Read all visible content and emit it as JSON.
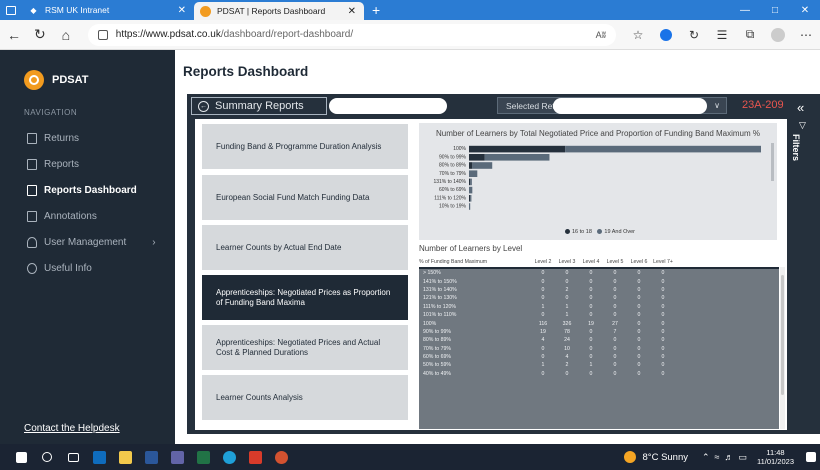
{
  "browser": {
    "tabs": [
      {
        "title": "RSM UK Intranet",
        "active": false
      },
      {
        "title": "PDSAT | Reports Dashboard",
        "active": true
      }
    ],
    "new_tab": "+",
    "url_host": "https://www.pdsat.co.uk",
    "url_path": "/dashboard/report-dashboard/",
    "reader_icon": "Aʬ"
  },
  "sidebar": {
    "brand": "PDSAT",
    "heading": "NAVIGATION",
    "items": [
      {
        "label": "Returns",
        "icon": "arrow-in-icon",
        "active": false
      },
      {
        "label": "Reports",
        "icon": "report-icon",
        "active": false
      },
      {
        "label": "Reports Dashboard",
        "icon": "dashboard-icon",
        "active": true
      },
      {
        "label": "Annotations",
        "icon": "annotation-icon",
        "active": false
      },
      {
        "label": "User Management",
        "icon": "user-icon",
        "active": false
      },
      {
        "label": "Useful Info",
        "icon": "info-icon",
        "active": false
      }
    ],
    "user_mgmt_chevron": "›",
    "helpdesk": "Contact the Helpdesk"
  },
  "main": {
    "title": "Reports Dashboard"
  },
  "report": {
    "summary_label": "Summary Reports",
    "selected_return_label": "Selected Return",
    "return_code": "23A-209",
    "buttons": [
      {
        "label": "Funding Band & Programme Duration Analysis",
        "active": false
      },
      {
        "label": "European Social Fund Match Funding Data",
        "active": false
      },
      {
        "label": "Learner Counts by Actual End Date",
        "active": false
      },
      {
        "label": "Apprenticeships: Negotiated Prices as Proportion of Funding Band Maxima",
        "active": true
      },
      {
        "label": "Apprenticeships: Negotiated Prices and Actual Cost & Planned Durations",
        "active": false
      },
      {
        "label": "Learner Counts Analysis",
        "active": false
      }
    ],
    "filters_label": "Filters",
    "colors": {
      "dark": "#1f2a36",
      "series_a": "#25303c",
      "series_b": "#5a6a7a",
      "accent": "#e8554e"
    }
  },
  "chart_data": {
    "type": "bar",
    "orientation": "horizontal",
    "stacked": true,
    "title": "Number of Learners by Total Negotiated Price and Proportion of Funding Band Maximum %",
    "categories": [
      "100%",
      "90% to 99%",
      "80% to 89%",
      "70% to 79%",
      "131% to 140%",
      "60% to 69%",
      "111% to 120%",
      "10% to 19%"
    ],
    "series": [
      {
        "name": "16 to 18",
        "values": [
          116,
          19,
          4,
          0,
          1,
          0,
          1,
          0
        ],
        "color": "#25303c"
      },
      {
        "name": "19 And Over",
        "values": [
          236,
          78,
          24,
          10,
          2,
          4,
          1,
          1
        ],
        "color": "#5a6a7a"
      }
    ],
    "legend": "bottom-center",
    "grid": false
  },
  "table": {
    "title": "Number of Learners by Level",
    "columns": [
      "% of Funding Band Maximum",
      "Level 2",
      "Level 3",
      "Level 4",
      "Level 5",
      "Level 6",
      "Level 7+"
    ],
    "rows": [
      [
        "> 150%",
        "0",
        "0",
        "0",
        "0",
        "0",
        "0"
      ],
      [
        "141% to 150%",
        "0",
        "0",
        "0",
        "0",
        "0",
        "0"
      ],
      [
        "131% to 140%",
        "0",
        "2",
        "0",
        "0",
        "0",
        "0"
      ],
      [
        "121% to 130%",
        "0",
        "0",
        "0",
        "0",
        "0",
        "0"
      ],
      [
        "111% to 120%",
        "1",
        "1",
        "0",
        "0",
        "0",
        "0"
      ],
      [
        "101% to 110%",
        "0",
        "1",
        "0",
        "0",
        "0",
        "0"
      ],
      [
        "100%",
        "116",
        "326",
        "19",
        "27",
        "0",
        "0"
      ],
      [
        "90% to 99%",
        "19",
        "78",
        "0",
        "7",
        "0",
        "0"
      ],
      [
        "80% to 89%",
        "4",
        "24",
        "0",
        "0",
        "0",
        "0"
      ],
      [
        "70% to 79%",
        "0",
        "10",
        "0",
        "0",
        "0",
        "0"
      ],
      [
        "60% to 69%",
        "0",
        "4",
        "0",
        "0",
        "0",
        "0"
      ],
      [
        "50% to 59%",
        "1",
        "2",
        "1",
        "0",
        "0",
        "0"
      ],
      [
        "40% to 49%",
        "0",
        "0",
        "0",
        "0",
        "0",
        "0"
      ]
    ]
  },
  "taskbar": {
    "weather": "8°C  Sunny",
    "time": "11:48",
    "date": "11/01/2023"
  }
}
